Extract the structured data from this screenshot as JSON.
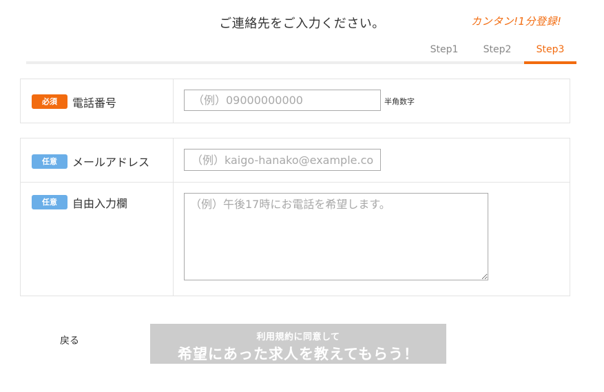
{
  "header": {
    "title": "ご連絡先をご入力ください。",
    "promo": "カンタン!1分登録!"
  },
  "steps": [
    {
      "label": "Step1",
      "active": false
    },
    {
      "label": "Step2",
      "active": false
    },
    {
      "label": "Step3",
      "active": true
    }
  ],
  "colors": {
    "accent": "#f26b0f",
    "required_badge": "#f26b0f",
    "optional_badge": "#6aaee8",
    "disabled_button": "#cccccc"
  },
  "form": {
    "phone": {
      "badge": "必須",
      "label": "電話番号",
      "placeholder": "（例）09000000000",
      "value": "",
      "hint": "半角数字"
    },
    "email": {
      "badge": "任意",
      "label": "メールアドレス",
      "placeholder": "（例）kaigo-hanako@example.com",
      "value": ""
    },
    "free_text": {
      "badge": "任意",
      "label": "自由入力欄",
      "placeholder": "（例）午後17時にお電話を希望します。",
      "value": ""
    }
  },
  "actions": {
    "back": "戻る",
    "submit_sub": "利用規約に同意して",
    "submit_main": "希望にあった求人を教えてもらう！",
    "submit_enabled": false
  }
}
